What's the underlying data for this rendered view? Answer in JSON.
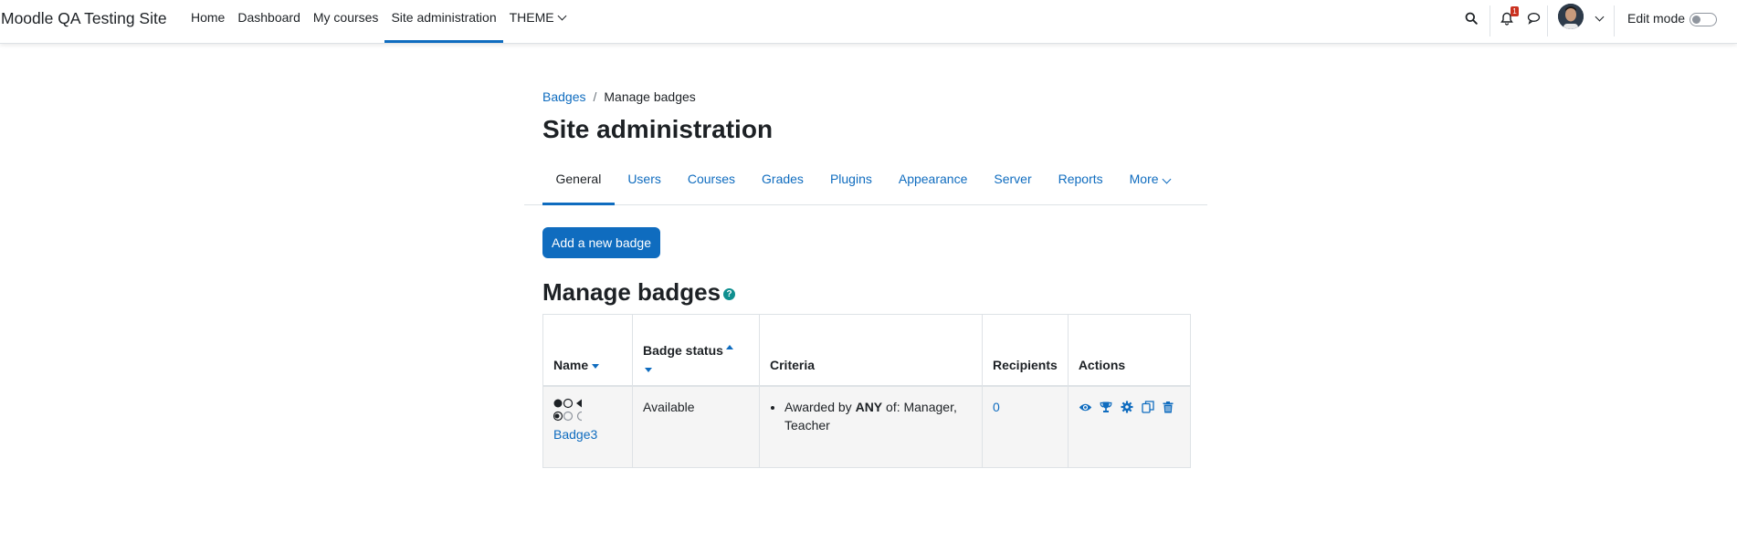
{
  "navbar": {
    "site_name": "Moodle QA Testing Site",
    "items": [
      {
        "label": "Home"
      },
      {
        "label": "Dashboard"
      },
      {
        "label": "My courses"
      },
      {
        "label": "Site administration"
      },
      {
        "label": "THEME"
      }
    ],
    "notification_count": "1",
    "edit_mode_label": "Edit mode"
  },
  "breadcrumb": {
    "items": [
      "Badges",
      "Manage badges"
    ],
    "separator": "/"
  },
  "page_title": "Site administration",
  "secondary_nav": {
    "tabs": [
      "General",
      "Users",
      "Courses",
      "Grades",
      "Plugins",
      "Appearance",
      "Server",
      "Reports",
      "More"
    ]
  },
  "add_button_label": "Add a new badge",
  "section_title": "Manage badges",
  "table": {
    "headers": [
      "Name",
      "Badge status",
      "Criteria",
      "Recipients",
      "Actions"
    ],
    "rows": [
      {
        "name": "Badge3",
        "status": "Available",
        "criteria_prefix": "Awarded by",
        "criteria_bold": "ANY",
        "criteria_suffix": "of: Manager, Teacher",
        "recipients": "0",
        "actions": [
          "eye-icon",
          "trophy-icon",
          "gear-icon",
          "copy-icon",
          "trash-icon"
        ]
      }
    ]
  },
  "colors": {
    "primary": "#0f6cbf",
    "text": "#1d2125",
    "notification": "#ca3120"
  }
}
